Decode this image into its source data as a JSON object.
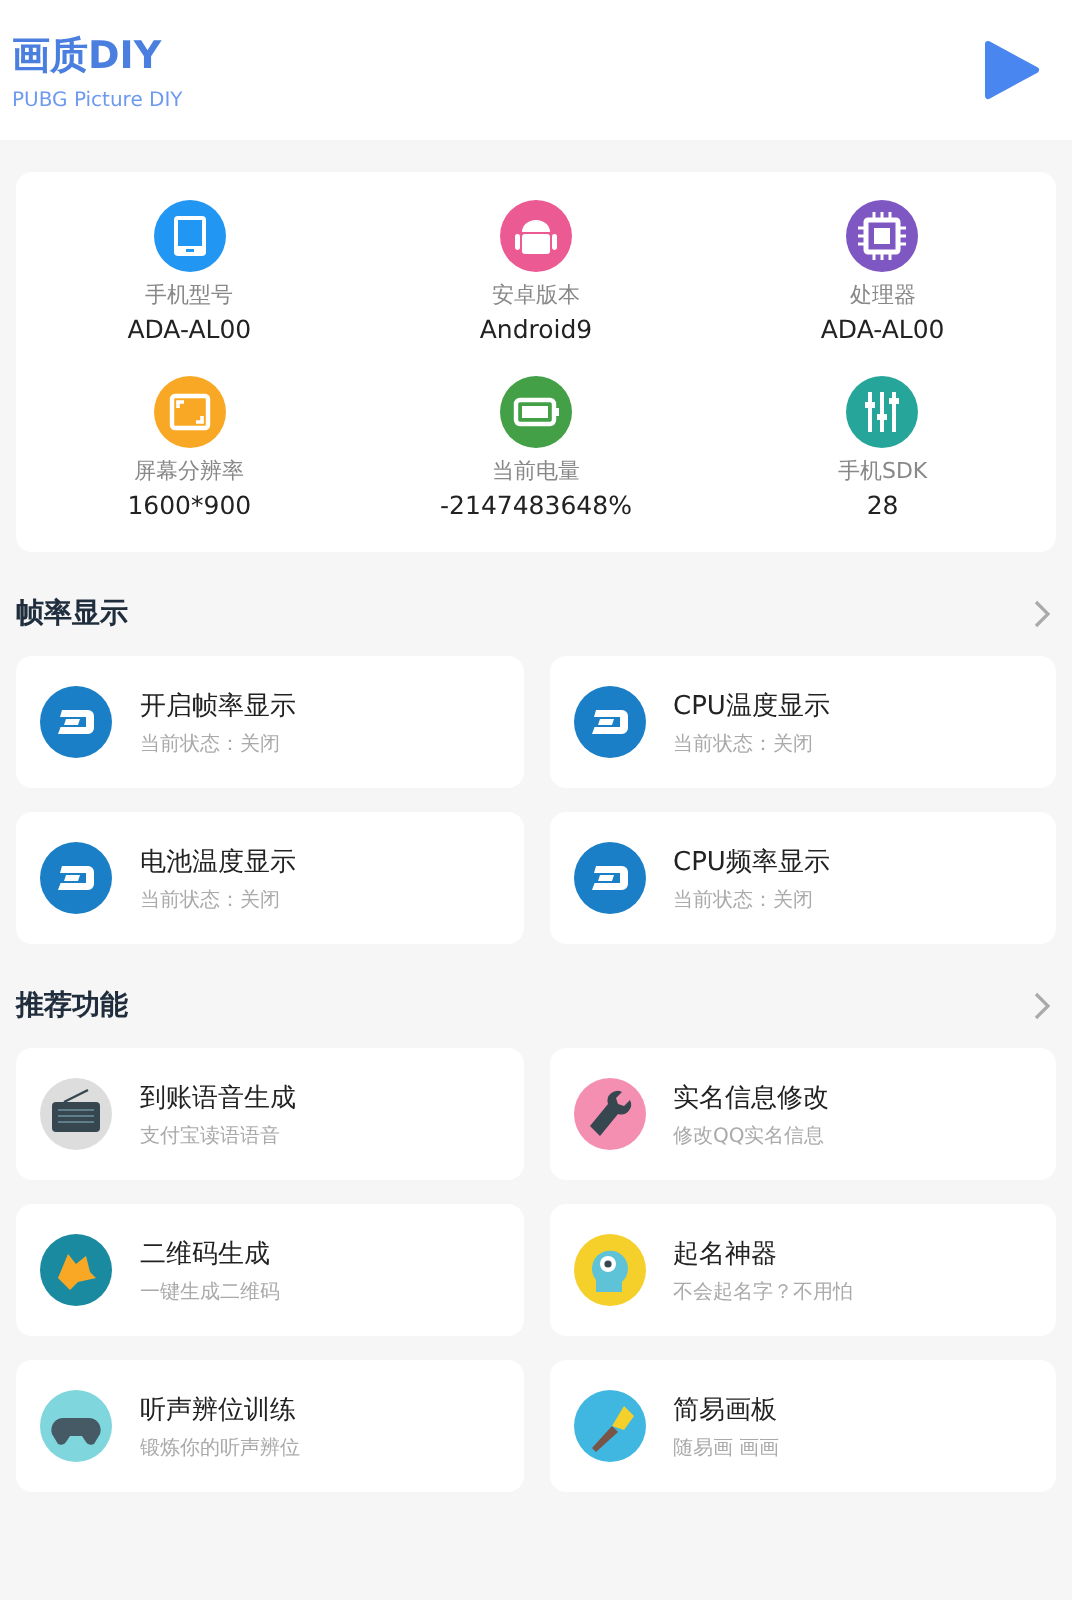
{
  "header": {
    "title": "画质DIY",
    "subtitle": "PUBG Picture DIY"
  },
  "device_info": [
    {
      "label": "手机型号",
      "value": "ADA-AL00",
      "color": "#2196f3"
    },
    {
      "label": "安卓版本",
      "value": "Android9",
      "color": "#ec5a94"
    },
    {
      "label": "处理器",
      "value": "ADA-AL00",
      "color": "#7e57c2"
    },
    {
      "label": "屏幕分辨率",
      "value": "1600*900",
      "color": "#f9a825"
    },
    {
      "label": "当前电量",
      "value": "-2147483648%",
      "color": "#43a047"
    },
    {
      "label": "手机SDK",
      "value": "28",
      "color": "#26a69a"
    }
  ],
  "sections": [
    {
      "title": "帧率显示",
      "items": [
        {
          "title": "开启帧率显示",
          "subtitle": "当前状态：关闭"
        },
        {
          "title": "CPU温度显示",
          "subtitle": "当前状态：关闭"
        },
        {
          "title": "电池温度显示",
          "subtitle": "当前状态：关闭"
        },
        {
          "title": "CPU频率显示",
          "subtitle": "当前状态：关闭"
        }
      ]
    },
    {
      "title": "推荐功能",
      "items": [
        {
          "title": "到账语音生成",
          "subtitle": "支付宝读语语音"
        },
        {
          "title": "实名信息修改",
          "subtitle": "修改QQ实名信息"
        },
        {
          "title": "二维码生成",
          "subtitle": "一键生成二维码"
        },
        {
          "title": "起名神器",
          "subtitle": "不会起名字？不用怕"
        },
        {
          "title": "听声辨位训练",
          "subtitle": "锻炼你的听声辨位"
        },
        {
          "title": "简易画板",
          "subtitle": "随易画 画画"
        }
      ]
    }
  ]
}
